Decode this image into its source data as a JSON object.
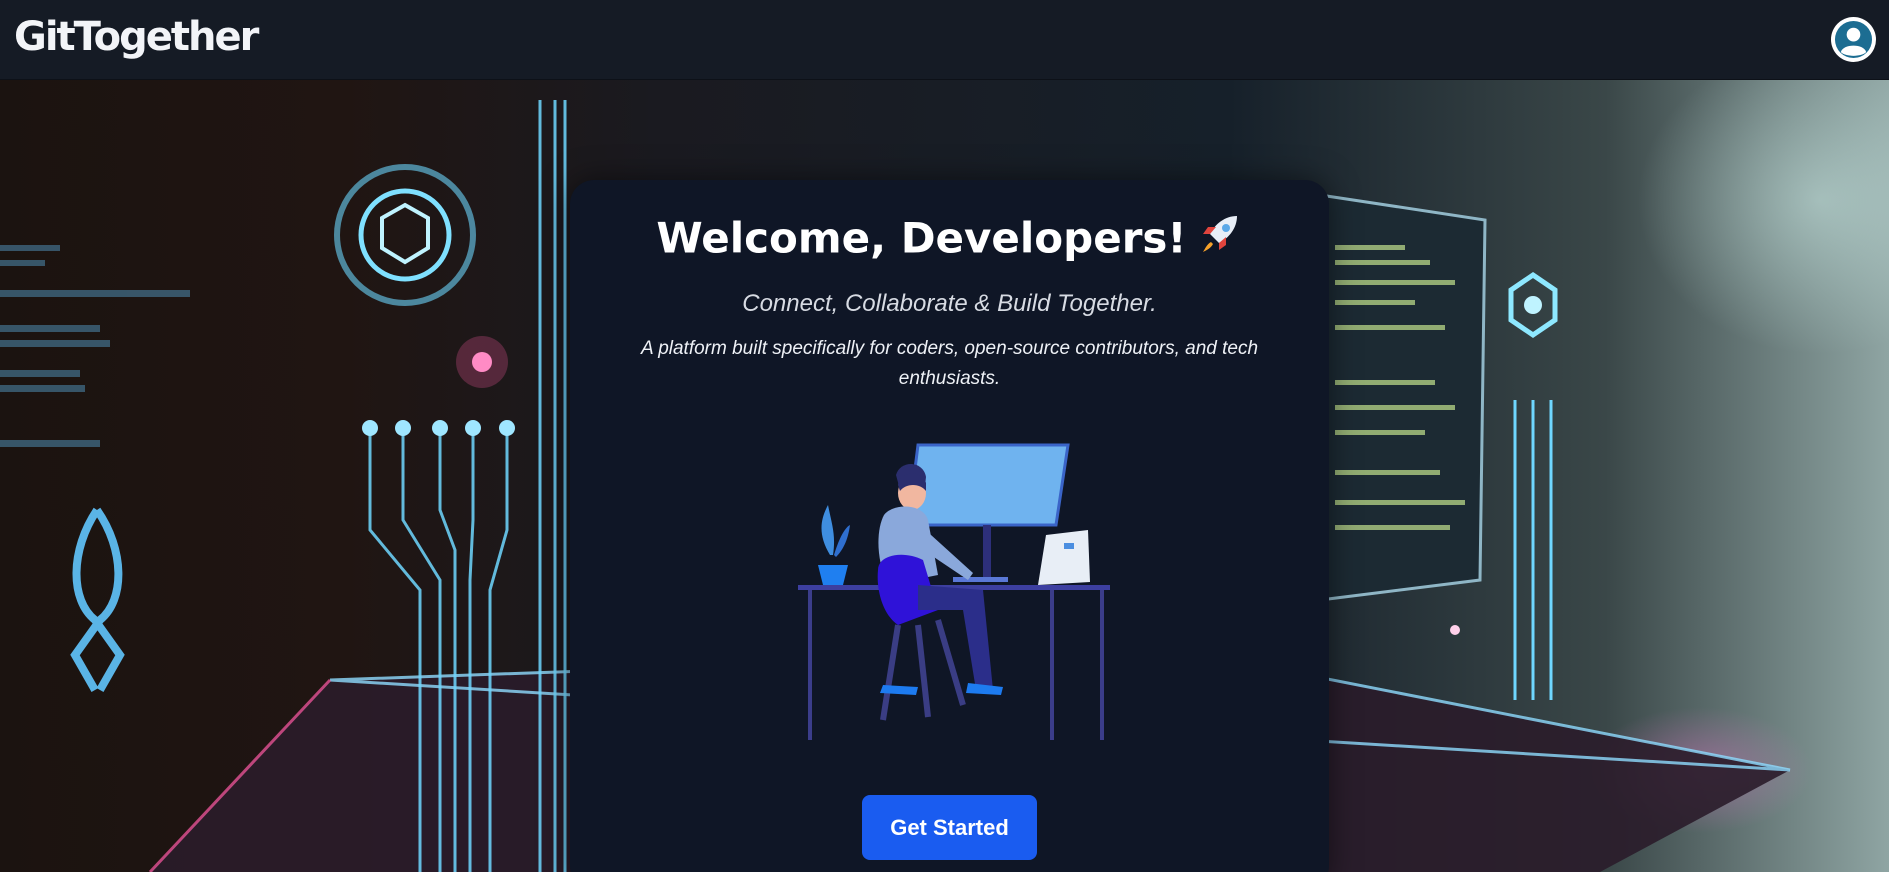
{
  "navbar": {
    "logo_text": "GitTogether"
  },
  "hero": {
    "title": "Welcome, Developers!",
    "subtitle": "Connect, Collaborate & Build Together.",
    "description": "A platform built specifically for coders, open-source contributors, and tech enthusiasts.",
    "cta_label": "Get Started"
  },
  "colors": {
    "navbar_bg": "#151b25",
    "card_bg": "#0f1626",
    "accent": "#1a5cf0"
  },
  "icons": [
    "user-avatar-icon",
    "rocket-icon"
  ]
}
